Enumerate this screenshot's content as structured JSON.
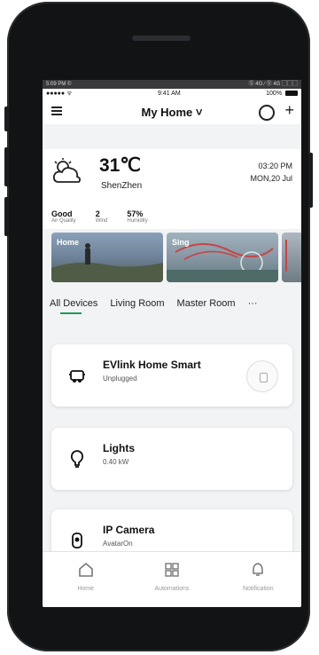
{
  "android_status": {
    "left": "5:09 PM ©",
    "right": "Ⓢ 4G ∕ Ⓢ 4G ▢▢▢"
  },
  "ios_status": {
    "left": "●●●●● ᯤ",
    "center": "9:41 AM",
    "right": "100%"
  },
  "header": {
    "title": "My Home ˅"
  },
  "weather": {
    "temperature": "31℃",
    "city": "ShenZhen",
    "time": "03:20 PM",
    "date": "MON,20 Jul",
    "stats": [
      {
        "value": "Good",
        "label": "Air Quality"
      },
      {
        "value": "2",
        "label": "Wind"
      },
      {
        "value": "57%",
        "label": "Humidity"
      }
    ]
  },
  "scenes": [
    {
      "label": "Home"
    },
    {
      "label": "Sing"
    },
    {
      "label": ""
    }
  ],
  "tabs": [
    "All Devices",
    "Living Room",
    "Master Room",
    "···"
  ],
  "devices": [
    {
      "name": "EVlink Home Smart",
      "status": "Unplugged"
    },
    {
      "name": "Lights",
      "status": "0.40 kW"
    },
    {
      "name": "IP Camera",
      "status": "AvatarOn"
    }
  ],
  "bottom_nav": [
    {
      "label": "Home",
      "icon": "home-icon"
    },
    {
      "label": "Automations",
      "icon": "grid-icon"
    },
    {
      "label": "Notification",
      "icon": "bell-icon"
    }
  ],
  "colors": {
    "accent": "#1d9a54",
    "background": "#f2f3f5"
  }
}
